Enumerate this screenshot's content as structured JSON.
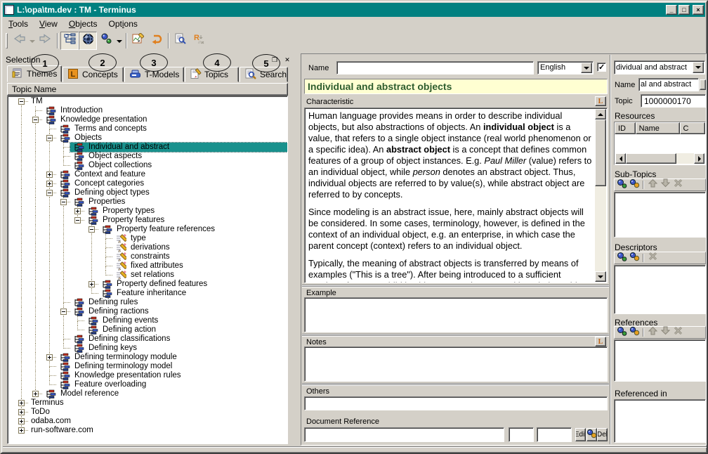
{
  "window": {
    "title": "L:\\opa\\tm.dev : TM - Terminus"
  },
  "menu": {
    "items": [
      {
        "label": "Tools",
        "accel": 0
      },
      {
        "label": "View",
        "accel": 0
      },
      {
        "label": "Objects",
        "accel": 0
      },
      {
        "label": "Options",
        "accel": 3
      }
    ]
  },
  "toolbar": {
    "icons": [
      "back-icon",
      "back-dropdown-icon",
      "forward-icon",
      "tree-view-icon",
      "globe-icon",
      "objects-icon",
      "objects-dropdown-icon",
      "edit-icon",
      "revert-icon",
      "report-icon",
      "references-icon"
    ]
  },
  "selection_pane": {
    "header": "Selection",
    "annotations": [
      "1",
      "2",
      "3",
      "4",
      "5"
    ],
    "tabs": [
      {
        "label": "Themes",
        "icon": "themes-icon"
      },
      {
        "label": "Concepts",
        "icon": "concepts-icon"
      },
      {
        "label": "T-Models",
        "icon": "tmodels-icon"
      },
      {
        "label": "Topics",
        "icon": "topics-icon"
      },
      {
        "label": "Search",
        "icon": "search-icon"
      }
    ],
    "column_header": "Topic Name",
    "tree": [
      {
        "label": "TM",
        "level": 0,
        "expand": "minus",
        "icon": "none"
      },
      {
        "label": "Introduction",
        "level": 1,
        "expand": "none",
        "icon": "topic"
      },
      {
        "label": "Knowledge presentation",
        "level": 1,
        "expand": "minus",
        "icon": "topic"
      },
      {
        "label": "Terms and concepts",
        "level": 2,
        "expand": "none",
        "icon": "topic"
      },
      {
        "label": "Objects",
        "level": 2,
        "expand": "minus",
        "icon": "topic"
      },
      {
        "label": "Individual and abstract",
        "level": 3,
        "expand": "none",
        "icon": "topic",
        "selected": true
      },
      {
        "label": "Object aspects",
        "level": 3,
        "expand": "none",
        "icon": "topic"
      },
      {
        "label": "Object collections",
        "level": 3,
        "expand": "none",
        "icon": "topic"
      },
      {
        "label": "Context and feature",
        "level": 2,
        "expand": "plus",
        "icon": "topic"
      },
      {
        "label": "Concept categories",
        "level": 2,
        "expand": "plus",
        "icon": "topic"
      },
      {
        "label": "Defining object types",
        "level": 2,
        "expand": "minus",
        "icon": "topic"
      },
      {
        "label": "Properties",
        "level": 3,
        "expand": "minus",
        "icon": "topic"
      },
      {
        "label": "Property types",
        "level": 4,
        "expand": "plus",
        "icon": "topic"
      },
      {
        "label": "Property features",
        "level": 4,
        "expand": "minus",
        "icon": "topic"
      },
      {
        "label": "Property feature references",
        "level": 5,
        "expand": "minus",
        "icon": "topic"
      },
      {
        "label": "type",
        "level": 6,
        "expand": "none",
        "icon": "pencil"
      },
      {
        "label": "derivations",
        "level": 6,
        "expand": "none",
        "icon": "pencil"
      },
      {
        "label": "constraints",
        "level": 6,
        "expand": "none",
        "icon": "pencil"
      },
      {
        "label": "fixed attributes",
        "level": 6,
        "expand": "none",
        "icon": "pencil"
      },
      {
        "label": "set relations",
        "level": 6,
        "expand": "none",
        "icon": "pencil"
      },
      {
        "label": "Property defined features",
        "level": 5,
        "expand": "plus",
        "icon": "topic"
      },
      {
        "label": "Feature inheritance",
        "level": 5,
        "expand": "none",
        "icon": "topic"
      },
      {
        "label": "Defining rules",
        "level": 3,
        "expand": "none",
        "icon": "topic"
      },
      {
        "label": "Defining ractions",
        "level": 3,
        "expand": "minus",
        "icon": "topic"
      },
      {
        "label": "Defining events",
        "level": 4,
        "expand": "none",
        "icon": "topic"
      },
      {
        "label": "Defining action",
        "level": 4,
        "expand": "none",
        "icon": "topic"
      },
      {
        "label": "Defining classifications",
        "level": 3,
        "expand": "none",
        "icon": "topic"
      },
      {
        "label": "Defining keys",
        "level": 3,
        "expand": "none",
        "icon": "topic"
      },
      {
        "label": "Defining terminology module",
        "level": 2,
        "expand": "plus",
        "icon": "topic"
      },
      {
        "label": "Defining terminology model",
        "level": 2,
        "expand": "none",
        "icon": "topic"
      },
      {
        "label": "Knowledge presentation rules",
        "level": 2,
        "expand": "none",
        "icon": "topic"
      },
      {
        "label": "Feature overloading",
        "level": 2,
        "expand": "none",
        "icon": "topic"
      },
      {
        "label": "Model reference",
        "level": 1,
        "expand": "plus",
        "icon": "topic"
      },
      {
        "label": "Terminus",
        "level": 0,
        "expand": "plus",
        "icon": "none"
      },
      {
        "label": "ToDo",
        "level": 0,
        "expand": "plus",
        "icon": "none"
      },
      {
        "label": "odaba.com",
        "level": 0,
        "expand": "plus",
        "icon": "none"
      },
      {
        "label": "run-software.com",
        "level": 0,
        "expand": "plus",
        "icon": "none"
      }
    ]
  },
  "form": {
    "name_label": "Name",
    "name_value": "",
    "language_value": "English",
    "title": "Individual and abstract objects",
    "characteristic_label": "Characteristic",
    "characteristic_paragraphs": [
      [
        {
          "t": "Human language provides means in order to describe individual objects, but also abstractions of objects. An "
        },
        {
          "t": "individual object",
          "b": true
        },
        {
          "t": " is a value, that refers to a single object instance (real world phenomenon or a specific idea). An "
        },
        {
          "t": "abstract object",
          "b": true
        },
        {
          "t": " is a concept that defines common features of a group of object instances. E.g. "
        },
        {
          "t": "Paul Miller",
          "i": true
        },
        {
          "t": " (value) refers to an individual object, while "
        },
        {
          "t": "person",
          "i": true
        },
        {
          "t": " denotes an abstract object. Thus, individual objects are referred to by value(s), while abstract object are referred to by concepts."
        }
      ],
      [
        {
          "t": "Since modeling is an abstract issue, here, mainly abstract objects will be considered. In some cases, terminology, however, is defined in the context of an individual object, e.g. an enterprise, in which case the parent concept (context) refers to an individual object."
        }
      ],
      [
        {
          "t": "Typically, the meaning of abstract objects is transferred by means of examples (\"This is a tree\"). After being introduced to a sufficient number of trees, a child is able to recognize trees without being told."
        }
      ]
    ],
    "example_label": "Example",
    "example_value": "",
    "notes_label": "Notes",
    "notes_value": "",
    "others_label": "Others",
    "others_value": "",
    "docref_label": "Document Reference",
    "docref_value": "",
    "docref_page": "",
    "docref_pos": "",
    "edit_button": "Edit",
    "del_button": "Del"
  },
  "right_panel": {
    "topic_combo_value": "dividual and abstract",
    "name_label": "Name",
    "name_value": "al and abstract",
    "topic_label": "Topic",
    "topic_value": "1000000170",
    "resources_label": "Resources",
    "resources_columns": [
      "ID",
      "Name",
      "C"
    ],
    "subtopics_label": "Sub-Topics",
    "descriptors_label": "Descriptors",
    "references_label": "References",
    "referenced_in_label": "Referenced in"
  }
}
